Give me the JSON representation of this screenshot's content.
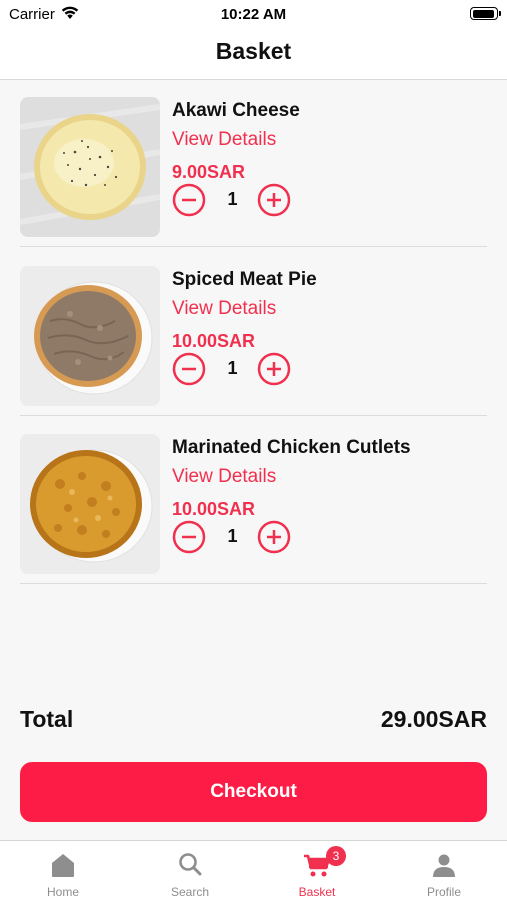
{
  "status_bar": {
    "carrier": "Carrier",
    "time": "10:22 AM"
  },
  "header": {
    "title": "Basket"
  },
  "basket": {
    "items": [
      {
        "name": "Akawi Cheese",
        "details_label": "View Details",
        "price": "9.00SAR",
        "quantity": "1"
      },
      {
        "name": "Spiced Meat Pie",
        "details_label": "View Details",
        "price": "10.00SAR",
        "quantity": "1"
      },
      {
        "name": "Marinated Chicken Cutlets",
        "details_label": "View Details",
        "price": "10.00SAR",
        "quantity": "1"
      }
    ],
    "total_label": "Total",
    "total_value": "29.00SAR",
    "checkout_label": "Checkout"
  },
  "tab_bar": {
    "items": [
      {
        "label": "Home",
        "icon": "home-icon"
      },
      {
        "label": "Search",
        "icon": "search-icon"
      },
      {
        "label": "Basket",
        "icon": "cart-icon",
        "badge": "3",
        "active": true
      },
      {
        "label": "Profile",
        "icon": "person-icon"
      }
    ]
  },
  "colors": {
    "accent": "#f0304e",
    "checkout_button": "#fd1c46",
    "inactive_tab": "#8e8e8e"
  }
}
